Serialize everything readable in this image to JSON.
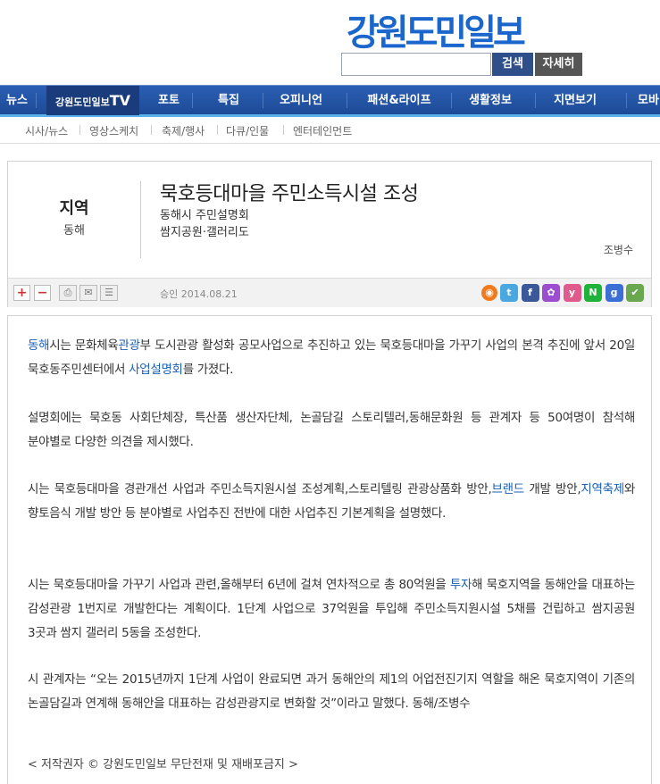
{
  "header": {
    "logo": "강원도민일보",
    "search_placeholder": "",
    "search_button": "검색",
    "detail_button": "자세히"
  },
  "nav": {
    "items": [
      "뉴스",
      "강원도민일보",
      "TV",
      "포토",
      "특집",
      "오피니언",
      "패션&라이프",
      "생활정보",
      "지면보기",
      "모바"
    ]
  },
  "subnav": {
    "items": [
      "시사/뉴스",
      "영상스케치",
      "축제/행사",
      "다큐/인물",
      "엔터테인먼트"
    ]
  },
  "article": {
    "category": "지역",
    "subcategory": "동해",
    "title": "묵호등대마을 주민소득시설 조성",
    "subtitle1": "동해시 주민설명회",
    "subtitle2": "쌈지공원·갤러리도",
    "reporter": "조병수",
    "approved": "승인 2014.08.21",
    "toolbar": {
      "plus": "+",
      "minus": "−"
    },
    "social_icons": [
      "rss-icon",
      "twitter-icon",
      "facebook-icon",
      "me2day-icon",
      "yozm-icon",
      "naver-icon",
      "google-icon",
      "delicious-icon"
    ],
    "social_colors": [
      "#f07b1e",
      "#4aa8e0",
      "#3b5998",
      "#9b4fd0",
      "#e05a8c",
      "#1fb33c",
      "#3b6fd6",
      "#6aa84f"
    ],
    "social_labels": [
      "◉",
      "t",
      "f",
      "✿",
      "y",
      "N",
      "g",
      "✔"
    ],
    "paragraphs": [
      [
        {
          "t": "동해",
          "kw": true
        },
        {
          "t": "시는 문화체육"
        },
        {
          "t": "관광",
          "kw": true
        },
        {
          "t": "부 도시관광 활성화 공모사업으로 추진하고 있는 묵호등대마을 가꾸기 사업의 본격 추진에 앞서 20일 묵호동주민센터에서 "
        },
        {
          "t": "사업설명회",
          "kw": true
        },
        {
          "t": "를 가졌다."
        }
      ],
      [
        {
          "t": "설명회에는 묵호동 사회단체장, 특산품 생산자단체, 논골담길 스토리텔러,동해문화원 등 관계자 등 50여명이 참석해 분야별로 다양한 의견을 제시했다."
        }
      ],
      [
        {
          "t": "시는 묵호등대마을 경관개선 사업과 주민소득지원시설 조성계획,스토리텔링 관광상품화 방안,"
        },
        {
          "t": "브랜드",
          "kw": true
        },
        {
          "t": " 개발 방안,"
        },
        {
          "t": "지역축제",
          "kw": true
        },
        {
          "t": "와 향토음식 개발 방안 등 분야별로 사업추진 전반에 대한 사업추진 기본계획을 설명했다."
        }
      ],
      [
        {
          "t": "시는 묵호등대마을 가꾸기 사업과 관련,올해부터 6년에 걸쳐 연차적으로 총 80억원을 "
        },
        {
          "t": "투자",
          "kw": true
        },
        {
          "t": "해 묵호지역을 동해안을 대표하는 감성관광 1번지로 개발한다는 계획이다. 1단계 사업으로 37억원을 투입해 주민소득지원시설 5채를 건립하고 쌈지공원 3곳과 쌈지 갤러리 5동을 조성한다."
        }
      ],
      [
        {
          "t": "시 관계자는 “오는 2015년까지 1단계 사업이 완료되면 과거 동해안의 제1의 어업전진기지 역할을 해온 묵호지역이 기존의 논골담길과 연계해 동해안을 대표하는 감성관광지로 변화할 것”이라고 말했다. 동해/조병수"
        }
      ]
    ],
    "copyright": "< 저작권자 © 강원도민일보 무단전재 및 재배포금지 >"
  }
}
